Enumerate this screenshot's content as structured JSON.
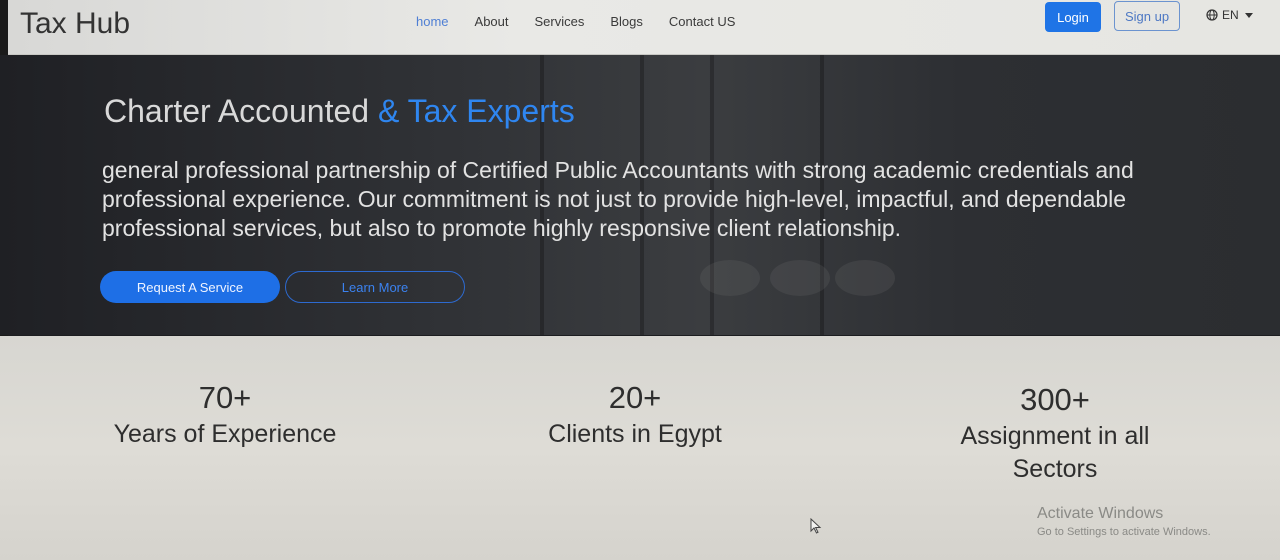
{
  "navbar": {
    "brand": "Tax Hub",
    "links": [
      "home",
      "About",
      "Services",
      "Blogs",
      "Contact US"
    ],
    "login_label": "Login",
    "signup_label": "Sign up",
    "language": "EN"
  },
  "hero": {
    "title_main": "Charter Accounted ",
    "title_accent": "& Tax Experts",
    "description": "general professional partnership of Certified Public Accountants with strong academic credentials and professional experience. Our commitment is not just to provide high-level, impactful, and dependable professional services, but also to promote highly responsive client relationship.",
    "request_button": "Request A Service",
    "learn_button": "Learn More"
  },
  "stats": [
    {
      "number": "70+",
      "label": "Years of Experience"
    },
    {
      "number": "20+",
      "label": "Clients in Egypt"
    },
    {
      "number": "300+",
      "label": "Assignment in all Sectors"
    }
  ],
  "watermark": {
    "title": "Activate Windows",
    "subtitle": "Go to Settings to activate Windows."
  },
  "colors": {
    "accent": "#1f74e6",
    "accent_text": "#2f86f0"
  }
}
